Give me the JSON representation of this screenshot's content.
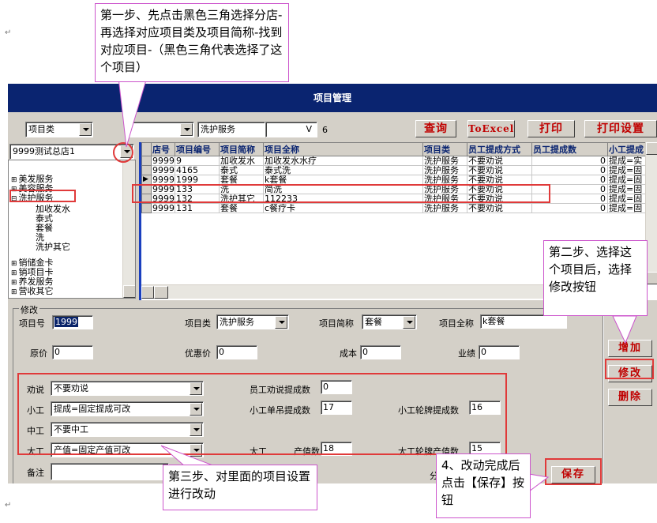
{
  "doc": {
    "para_mark": "↵"
  },
  "window": {
    "title": "项目管理"
  },
  "toolbar": {
    "category_combo": "项目类",
    "mid_combo": "",
    "service_field": "洗护服务",
    "vfield": "V",
    "count": "6",
    "query_label": "查询",
    "excel_label": "ToExcel",
    "print_label": "打印",
    "print_settings_label": "打印设置"
  },
  "tree": {
    "store_combo": "9999测试总店1",
    "nodes": [
      {
        "label": "美发服务",
        "expander": "⊞"
      },
      {
        "label": "美容服务",
        "expander": "⊞"
      },
      {
        "label": "洗护服务",
        "expander": "⊟"
      },
      {
        "label": "加收发水",
        "expander": ""
      },
      {
        "label": "泰式",
        "expander": ""
      },
      {
        "label": "套餐",
        "expander": ""
      },
      {
        "label": "洗",
        "expander": ""
      },
      {
        "label": "洗护其它",
        "expander": ""
      },
      {
        "label": "销储金卡",
        "expander": "⊞"
      },
      {
        "label": "销项目卡",
        "expander": "⊞"
      },
      {
        "label": "养发服务",
        "expander": "⊞"
      },
      {
        "label": "营收其它",
        "expander": "⊞"
      }
    ]
  },
  "grid": {
    "columns": [
      "店号",
      "项目编号",
      "项目简称",
      "项目全称",
      "项目类",
      "员工提成方式",
      "员工提成数",
      "小工提成"
    ],
    "rows": [
      {
        "indicator": "",
        "cells": [
          "9999",
          "9",
          "加收发水",
          "加收发水水疗",
          "洗护服务",
          "不要劝说",
          "0",
          "提成=实"
        ]
      },
      {
        "indicator": "",
        "cells": [
          "9999",
          "4165",
          "泰式",
          "泰式洗",
          "洗护服务",
          "不要劝说",
          "0",
          "提成=固"
        ]
      },
      {
        "indicator": "▶",
        "cells": [
          "9999",
          "1999",
          "套餐",
          "k套餐",
          "洗护服务",
          "不要劝说",
          "0",
          "提成=固"
        ]
      },
      {
        "indicator": "",
        "cells": [
          "9999",
          "133",
          "洗",
          "简洗",
          "洗护服务",
          "不要劝说",
          "0",
          "提成=固"
        ]
      },
      {
        "indicator": "",
        "cells": [
          "9999",
          "132",
          "洗护其它",
          "112233",
          "洗护服务",
          "不要劝说",
          "0",
          "提成=固"
        ]
      },
      {
        "indicator": "",
        "cells": [
          "9999",
          "131",
          "套餐",
          "c餐疗卡",
          "洗护服务",
          "不要劝说",
          "0",
          "提成=固"
        ]
      }
    ]
  },
  "form": {
    "group_title": "修改",
    "item_no_label": "项目号",
    "item_no_value": "1999",
    "category_label": "项目类",
    "category_value": "洗护服务",
    "short_name_label": "项目简称",
    "short_name_value": "套餐",
    "full_name_label": "项目全称",
    "full_name_value": "k套餐",
    "price_label": "原价",
    "price_value": "0",
    "discount_label": "优惠价",
    "discount_value": "0",
    "cost_label": "成本",
    "cost_value": "0",
    "performance_label": "业绩",
    "performance_value": "0",
    "persuade_label": "劝说",
    "persuade_value": "不要劝说",
    "staff_persuade_label": "员工劝说提成数",
    "staff_persuade_value": "0",
    "junior_label": "小工",
    "junior_value": "提成=固定提成可改",
    "junior_single_label": "小工单吊提成数",
    "junior_single_value": "17",
    "junior_rotate_label": "小工轮牌提成数",
    "junior_rotate_value": "16",
    "mid_label": "中工",
    "mid_value": "不要中工",
    "senior_label": "大工",
    "senior_value": "产值=固定产值可改",
    "senior_single_label": "大工",
    "senior_single_label_tail": "产值数",
    "senior_single_value": "18",
    "senior_rotate_label": "大工轮牌产值数",
    "senior_rotate_value": "15",
    "remarks_label": "备注",
    "right_partial_label": "分"
  },
  "side_buttons": {
    "add_label": "增加",
    "modify_label": "修改",
    "delete_label": "删除",
    "save_label": "保存"
  },
  "callouts": {
    "step1": "第一步、先点击黑色三角选择分店-再选择对应项目类及项目简称-找到对应项目-（黑色三角代表选择了这个项目）",
    "step2": "第二步、选择这个项目后，选择修改按钮",
    "step3": "第三步、对里面的项目设置进行改动",
    "step4": "4、改动完成后点击【保存】按钮"
  },
  "colors": {
    "accent_red": "#e03a3a",
    "callout_border": "#cc55cc",
    "title_bar": "#0a2470"
  }
}
